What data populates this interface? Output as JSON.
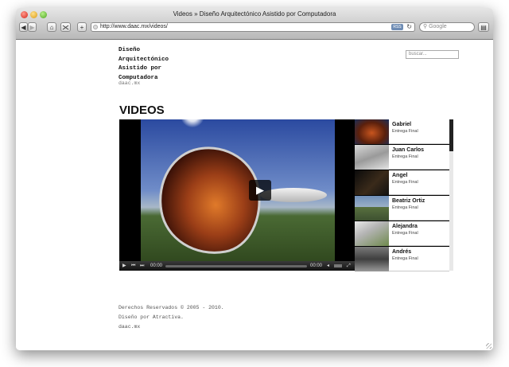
{
  "browser": {
    "title": "Videos » Diseño Arquitectónico Asistido por Computadora",
    "url": "http://www.daac.mx/videos/",
    "rss_label": "RSS",
    "search_placeholder": "Google",
    "back": "◀",
    "forward": "▶",
    "home": "⌂",
    "add": "+",
    "reload": "↻",
    "bookmarks": "▤"
  },
  "site": {
    "title": "Diseño Arquitectónico Asistido por Computadora",
    "domain": "daac.mx",
    "search_placeholder": "buscar..."
  },
  "page": {
    "heading": "VIDEOS"
  },
  "player": {
    "play_glyph": "▶",
    "time_current": "00:00",
    "time_total": "00:00",
    "progress": 0
  },
  "playlist": [
    {
      "name": "Gabriel",
      "subtitle": "Entrega Final"
    },
    {
      "name": "Juan Carlos",
      "subtitle": "Entrega Final"
    },
    {
      "name": "Angel",
      "subtitle": "Entrega Final"
    },
    {
      "name": "Beatriz Ortiz",
      "subtitle": "Entrega Final"
    },
    {
      "name": "Alejandra",
      "subtitle": "Entrega Final"
    },
    {
      "name": "Andrés",
      "subtitle": "Entrega Final"
    }
  ],
  "footer": {
    "copyright": "Derechos Reservados © 2005 - 2010.",
    "design": "Diseño por Atractiva.",
    "domain": "daac.mx"
  }
}
